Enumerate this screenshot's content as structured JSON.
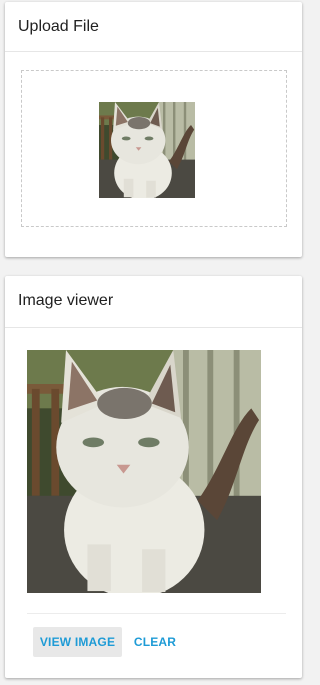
{
  "upload_card": {
    "title": "Upload File",
    "thumbnail_alt": "cat-photo"
  },
  "viewer_card": {
    "title": "Image viewer",
    "image_alt": "cat-photo",
    "view_button_label": "VIEW IMAGE",
    "clear_button_label": "CLEAR"
  },
  "colors": {
    "accent": "#1e9bd6",
    "page_background": "#f2f2f2",
    "card_background": "#ffffff",
    "button_background": "#e8e8e8"
  }
}
